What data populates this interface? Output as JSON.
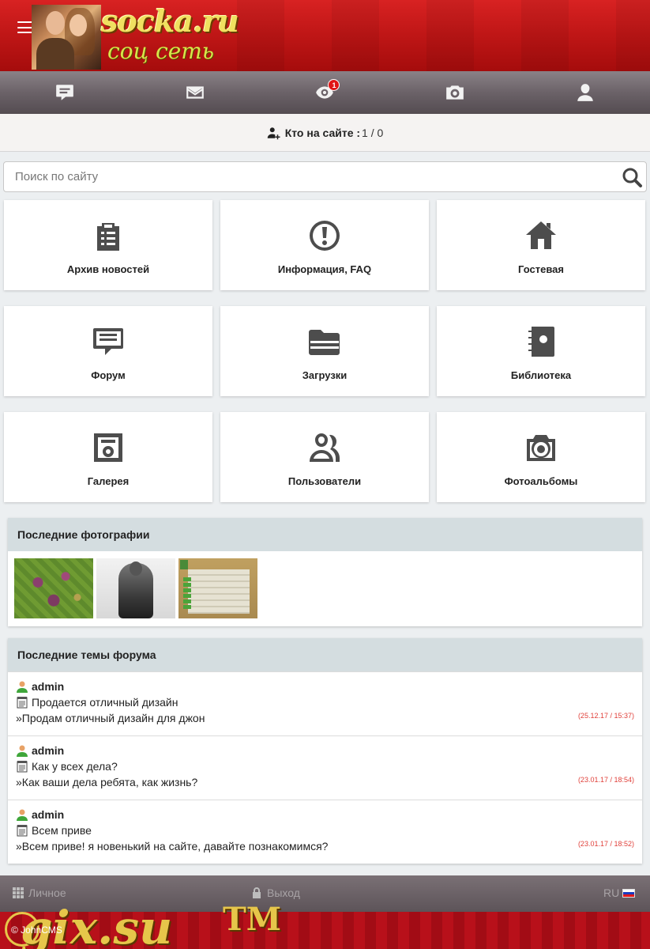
{
  "header": {
    "logo_title": "socka.ru",
    "logo_subtitle": "соц сеть"
  },
  "iconbar": {
    "items": [
      {
        "name": "messages",
        "icon": "chat-icon"
      },
      {
        "name": "mail",
        "icon": "envelope-icon"
      },
      {
        "name": "notifications",
        "icon": "eye-icon",
        "badge": "1"
      },
      {
        "name": "photos",
        "icon": "camera-icon"
      },
      {
        "name": "profile",
        "icon": "user-icon"
      }
    ]
  },
  "online": {
    "label": "Кто на сайте :",
    "count": "1 / 0"
  },
  "search": {
    "placeholder": "Поиск по сайту"
  },
  "tiles": [
    {
      "label": "Архив новостей",
      "icon": "clipboard-icon"
    },
    {
      "label": "Информация, FAQ",
      "icon": "exclamation-icon"
    },
    {
      "label": "Гостевая",
      "icon": "home-icon"
    },
    {
      "label": "Форум",
      "icon": "chat-bubble-icon"
    },
    {
      "label": "Загрузки",
      "icon": "folder-icon"
    },
    {
      "label": "Библиотека",
      "icon": "contact-book-icon"
    },
    {
      "label": "Галерея",
      "icon": "safe-icon"
    },
    {
      "label": "Пользователи",
      "icon": "users-icon"
    },
    {
      "label": "Фотоальбомы",
      "icon": "camera-icon"
    }
  ],
  "photos_panel": {
    "title": "Последние фотографии"
  },
  "forum_panel": {
    "title": "Последние темы форума",
    "topics": [
      {
        "author": "admin",
        "title": "Продается отличный дизайн",
        "preview": "»Продам отличный дизайн для джон",
        "date": "(25.12.17 / 15:37)"
      },
      {
        "author": "admin",
        "title": "Как у всех дела?",
        "preview": "»Как ваши дела ребята, как жизнь?",
        "date": "(23.01.17 / 18:54)"
      },
      {
        "author": "admin",
        "title": "Всем приве",
        "preview": "»Всем приве! я новенький на сайте, давайте познакомимся?",
        "date": "(23.01.17 / 18:52)"
      }
    ]
  },
  "footer": {
    "personal": "Личное",
    "logout": "Выход",
    "lang": "RU",
    "copyright": "© JohnCMS",
    "watermark": "gix.su",
    "trademark": "TM"
  },
  "colors": {
    "header_red": "#c11717",
    "nav_gray": "#6b6268",
    "panel_header": "#d4dde0",
    "date_red": "#e0403a"
  }
}
